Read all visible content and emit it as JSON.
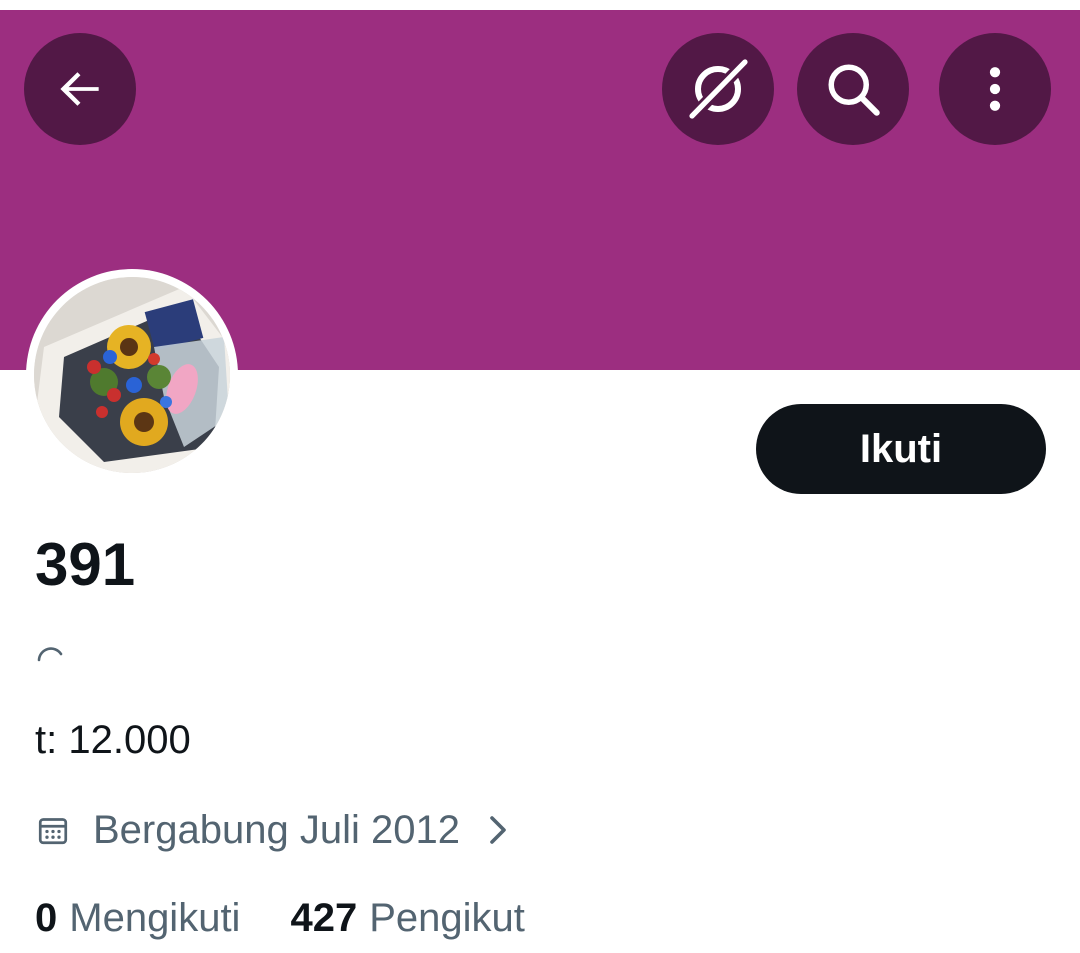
{
  "header": {
    "back_icon": "arrow-left-icon",
    "grok_icon": "grok-icon",
    "search_icon": "search-icon",
    "more_icon": "more-vertical-icon",
    "banner_color": "#9c2e80",
    "button_color": "#521846"
  },
  "profile": {
    "avatar": "profile-photo-flower-bouquet",
    "follow_label": "Ikuti",
    "display_name": "391",
    "bio": "t: 12.000",
    "joined": "Bergabung Juli 2012",
    "following_count": "0",
    "following_label": "Mengikuti",
    "followers_count": "427",
    "followers_label": "Pengikut"
  },
  "colors": {
    "primary_text": "#0f1419",
    "secondary_text": "#536471",
    "follow_button": "#0f1419"
  }
}
